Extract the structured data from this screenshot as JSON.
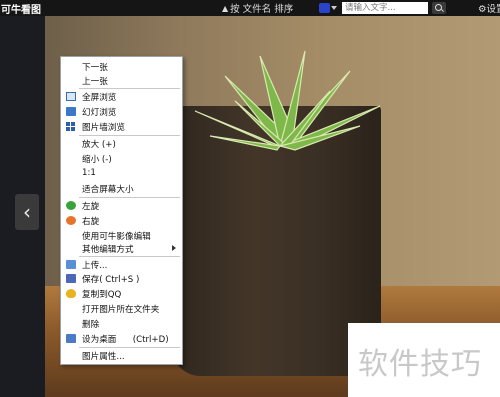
{
  "app": {
    "title": "可牛看图"
  },
  "toolbar": {
    "sort_label": "按 文件名 排序",
    "search_placeholder": "请输入文字...",
    "settings_label": "设置"
  },
  "context_menu": {
    "items": [
      {
        "label": "下一张"
      },
      {
        "label": "上一张"
      },
      {
        "label": "全屏浏览",
        "icon": "fullscreen-icon"
      },
      {
        "label": "幻灯浏览",
        "icon": "slideshow-icon"
      },
      {
        "label": "图片墙浏览",
        "icon": "thumbnails-icon"
      },
      {
        "label": "放大 (+)"
      },
      {
        "label": "缩小 (-)"
      },
      {
        "label": "1:1"
      },
      {
        "label": "适合屏幕大小"
      },
      {
        "label": "左旋",
        "icon": "rotate-left-icon"
      },
      {
        "label": "右旋",
        "icon": "rotate-right-icon"
      },
      {
        "label": "使用可牛影像编辑"
      },
      {
        "label": "其他编辑方式",
        "icon": "submenu-arrow-icon"
      },
      {
        "label": "上传...",
        "icon": "upload-icon"
      },
      {
        "label": "保存( Ctrl+S )",
        "icon": "save-icon"
      },
      {
        "label": "复制到QQ",
        "icon": "qq-icon"
      },
      {
        "label": "打开图片所在文件夹"
      },
      {
        "label": "删除"
      },
      {
        "label": "设为桌面      (Ctrl+D)",
        "icon": "desktop-icon"
      },
      {
        "label": "图片属性..."
      }
    ]
  },
  "watermark": {
    "text": "软件技巧"
  },
  "colors": {
    "menu_border": "#9aa0a8",
    "topbar": "#151515"
  }
}
